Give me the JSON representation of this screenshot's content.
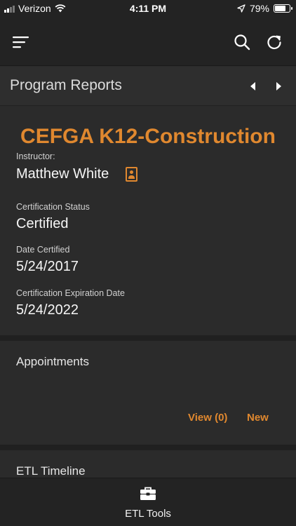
{
  "status_bar": {
    "carrier": "Verizon",
    "time": "4:11 PM",
    "battery_percent": "79%",
    "battery_level": 0.79
  },
  "nav": {
    "menu_icon": "menu-icon",
    "search_icon": "search-icon",
    "refresh_icon": "refresh-icon"
  },
  "header": {
    "title": "Program Reports"
  },
  "program": {
    "name": "CEFGA K12-Construction",
    "instructor_label": "Instructor:",
    "instructor_name": "Matthew White",
    "cert_status_label": "Certification Status",
    "cert_status_value": "Certified",
    "date_certified_label": "Date Certified",
    "date_certified_value": "5/24/2017",
    "expiration_label": "Certification Expiration Date",
    "expiration_value": "5/24/2022"
  },
  "appointments": {
    "title": "Appointments",
    "view_label": "View (0)",
    "new_label": "New"
  },
  "timeline": {
    "title": "ETL Timeline"
  },
  "tab_bar": {
    "tools_label": "ETL Tools"
  },
  "colors": {
    "accent": "#e0882f",
    "background": "#2a2a2a",
    "bar": "#232323"
  }
}
